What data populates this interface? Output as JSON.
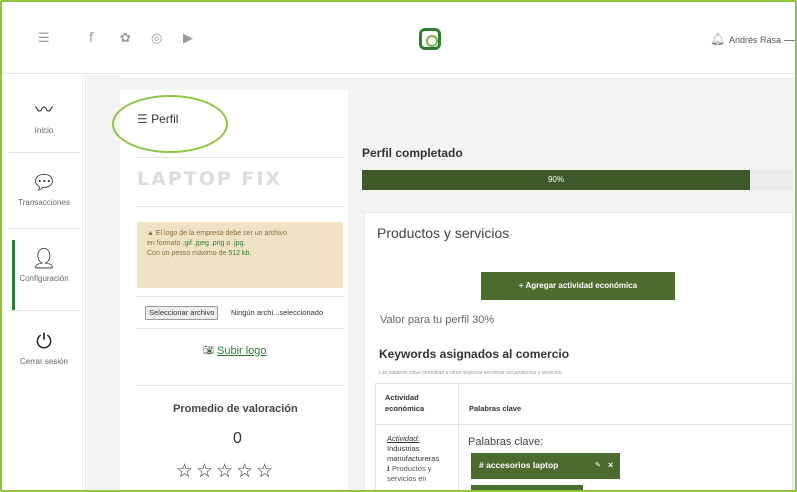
{
  "topbar": {
    "menu_icon": "menu-lines-icon",
    "social_icons": [
      "facebook-icon",
      "twitter-icon",
      "instagram-icon",
      "youtube-icon"
    ],
    "notification_icon": "bell-icon",
    "username": "Andrés Rasa"
  },
  "sidebar": {
    "items": [
      {
        "label": "Inicio",
        "icon": "chart-line-icon"
      },
      {
        "label": "Transacciones",
        "icon": "money-chat-icon"
      },
      {
        "label": "Configuración",
        "icon": "user-gear-icon"
      },
      {
        "label": "Cerrar sesión",
        "icon": "power-icon"
      }
    ],
    "active_index": 2
  },
  "profile": {
    "title": "Perfil",
    "company_logo_text": "LAPTOP FIX",
    "warning": {
      "line1": "El logo de la empresa debe ser un archivo",
      "line2_prefix": "en formato ",
      "formats": ".gif .jpeg .png o .jpg.",
      "line3_prefix": "Con un pesso máximo de ",
      "max_size": "512 kb."
    },
    "file_button": "Seleccionar archivo",
    "file_status": "Ningún archi...seleccionado",
    "upload_link": "Subir logo",
    "rating_title": "Promedio de valoración",
    "rating_value": "0",
    "stars": "☆☆☆☆☆"
  },
  "completion": {
    "title": "Perfil completado",
    "percent_label": "90%",
    "percent": 90
  },
  "products": {
    "title": "Productos y servicios",
    "add_button": "+ Agregar actividad económica",
    "value_text": "Valor para tu perfil 30%",
    "keywords_title": "Keywords asignados al comercio",
    "keywords_desc": "Las palabras clave permitirán a otros negocios encontrar tus productos y servicios.",
    "table": {
      "col_activity_1": "Actividad",
      "col_activity_2": "económica",
      "col_keywords": "Palabras clave",
      "row_activity_label": "Actividad:",
      "row_activity_1": "Industrias",
      "row_activity_2": "manufactureras",
      "row_info": "Productos y",
      "row_info_2": "servicios en",
      "row_keywords_label": "Palabras clave:",
      "tag": "# accesorios laptop"
    }
  },
  "colors": {
    "accent_green": "#4b6b2f",
    "highlight_green": "#8cc63f",
    "warning_bg": "#efe3c4"
  }
}
